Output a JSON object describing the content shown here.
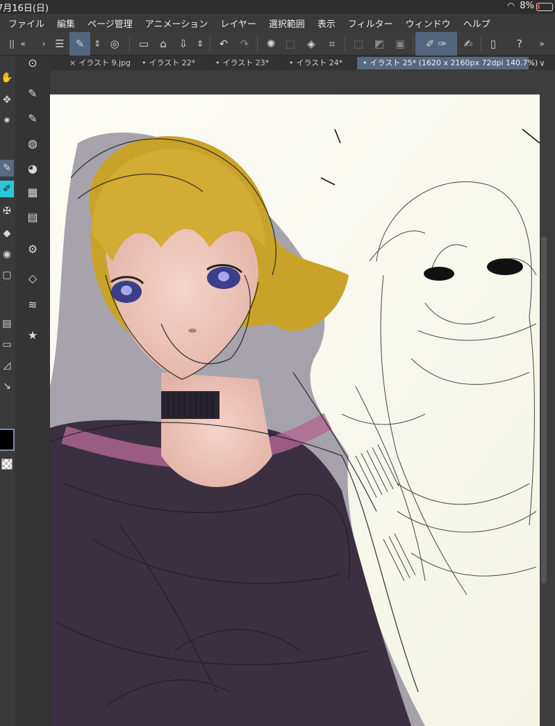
{
  "status": {
    "date": "7月16日(日)",
    "battery": "8%"
  },
  "menu": [
    "ファイル",
    "編集",
    "ページ管理",
    "アニメーション",
    "レイヤー",
    "選択範囲",
    "表示",
    "フィルター",
    "ウィンドウ",
    "ヘルプ"
  ],
  "tabs": [
    {
      "label": "イラスト 9.jpg",
      "mark": "×"
    },
    {
      "label": "イラスト 22*",
      "mark": "•"
    },
    {
      "label": "イラスト 23*",
      "mark": "•"
    },
    {
      "label": "イラスト 24*",
      "mark": "•"
    },
    {
      "label": "イラスト 25* (1620 x 2160px 72dpi 140.7%)",
      "mark": "•"
    }
  ],
  "colors": {
    "accent": "#566a82",
    "highlight": "#2ec5d8",
    "canvas": "#fbfbf3"
  }
}
